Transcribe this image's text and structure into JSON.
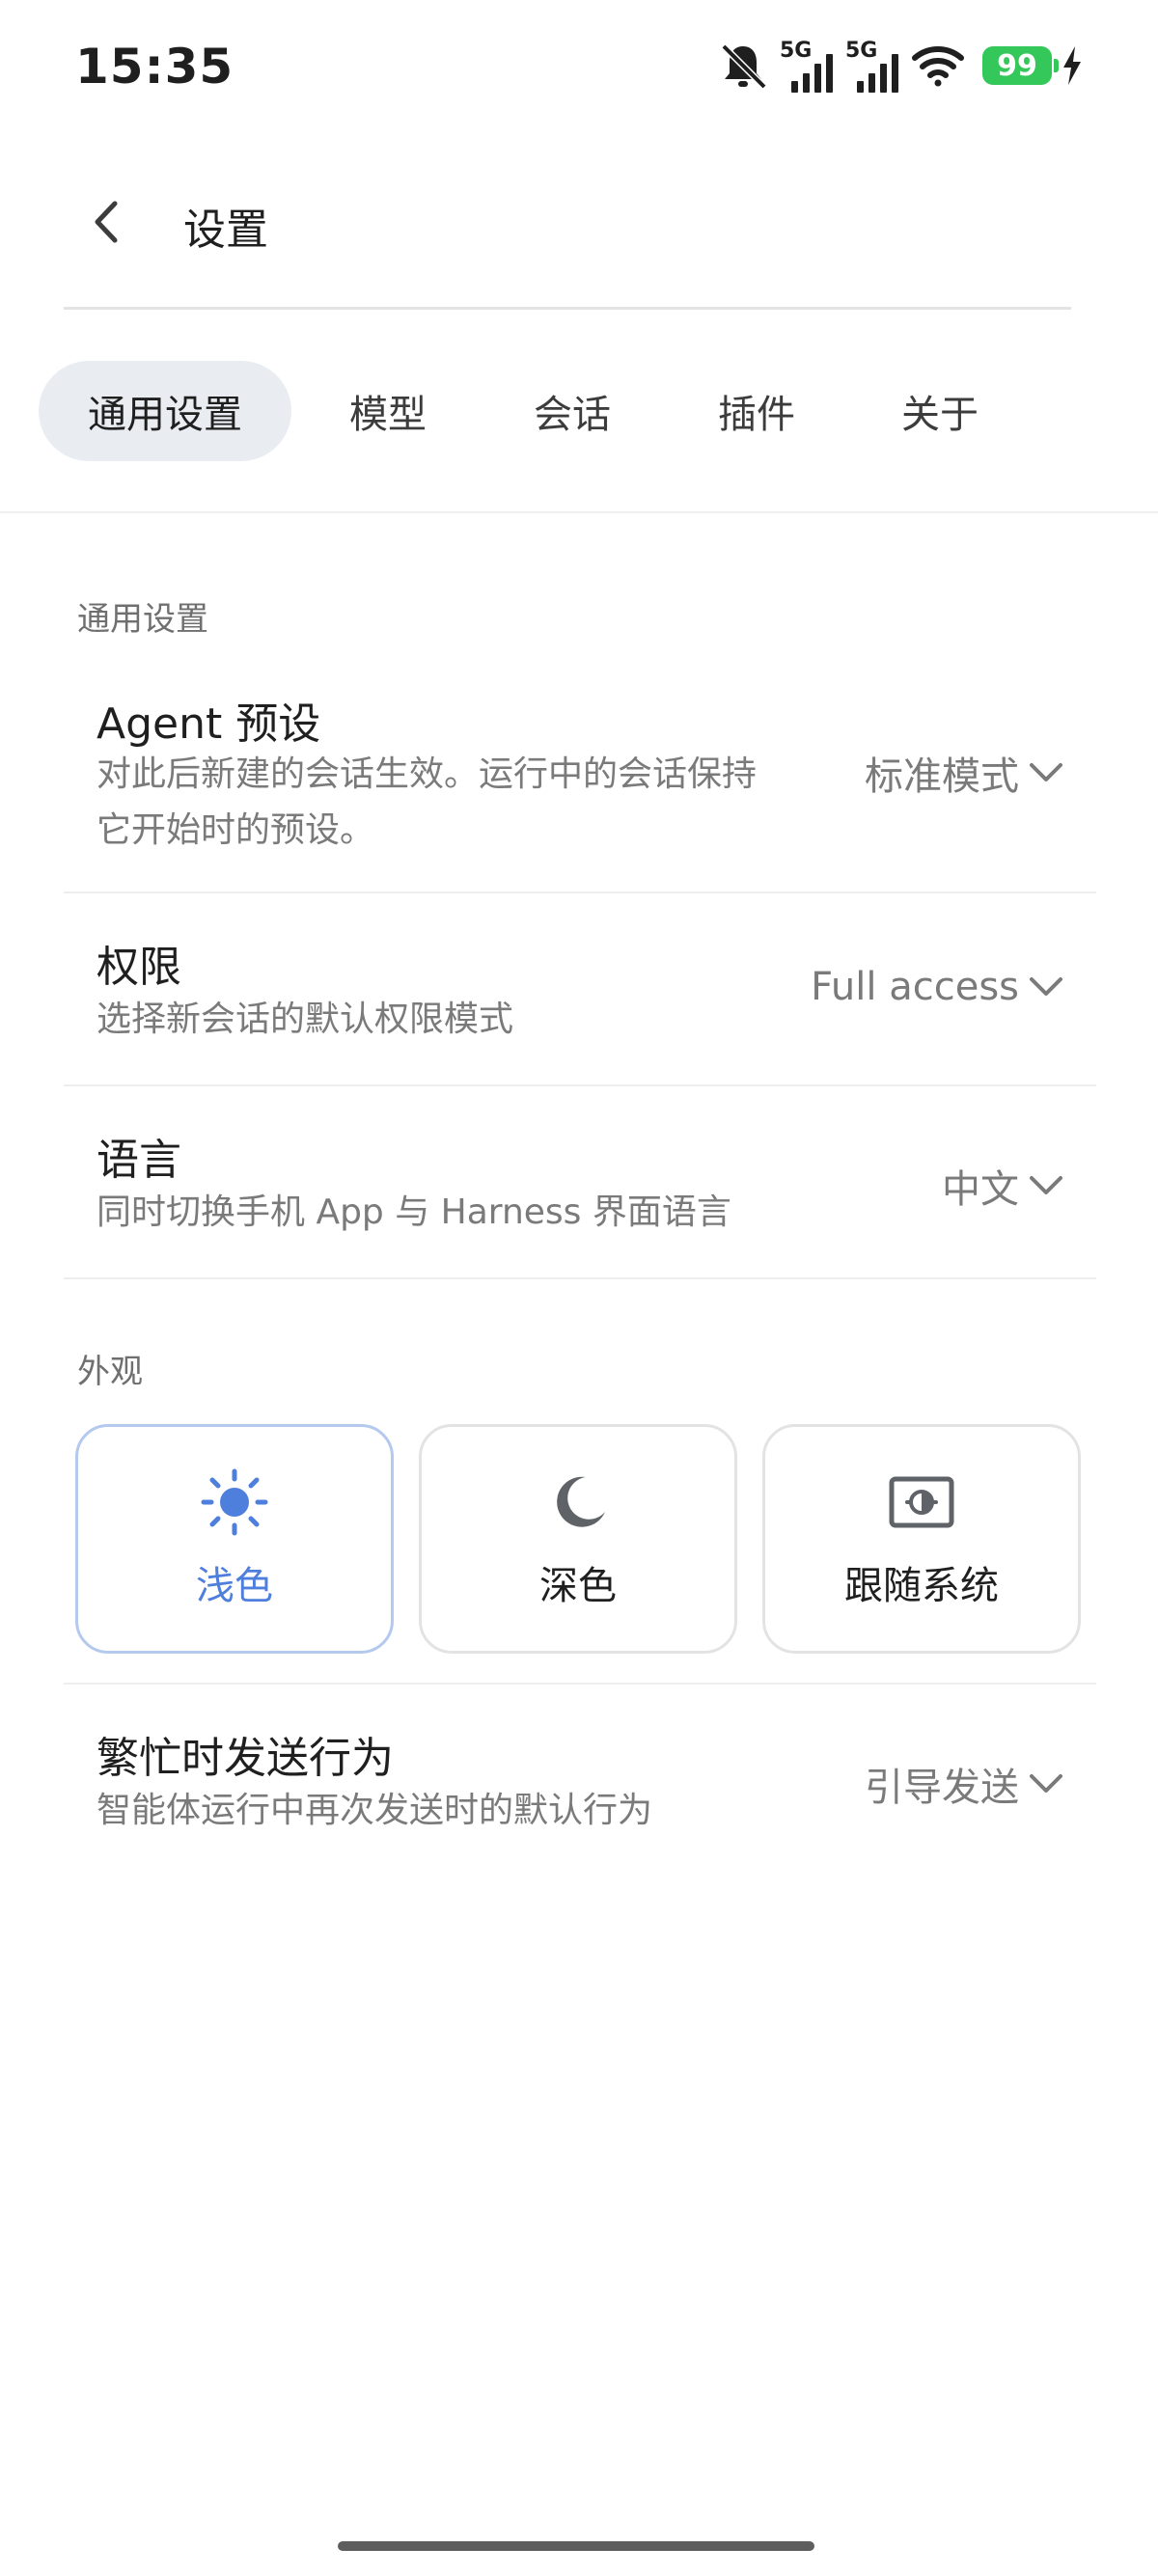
{
  "status_bar": {
    "time": "15:35",
    "network_1": "5G",
    "network_2": "5G",
    "battery": "99",
    "icons": [
      "bell-muted-icon",
      "signal-icon",
      "signal-icon",
      "wifi-icon",
      "battery-icon",
      "charging-bolt-icon"
    ]
  },
  "header": {
    "title": "设置",
    "back_icon": "chevron-left-icon"
  },
  "tabs": [
    {
      "label": "通用设置",
      "active": true
    },
    {
      "label": "模型",
      "active": false
    },
    {
      "label": "会话",
      "active": false
    },
    {
      "label": "插件",
      "active": false
    },
    {
      "label": "关于",
      "active": false
    }
  ],
  "general": {
    "section_label": "通用设置",
    "agent_preset": {
      "title": "Agent 预设",
      "desc_line1": "对此后新建的会话生效。运行中的会话保持",
      "desc_line2": "它开始时的预设。",
      "value": "标准模式"
    },
    "permissions": {
      "title": "权限",
      "desc": "选择新会话的默认权限模式",
      "value": "Full access"
    },
    "language": {
      "title": "语言",
      "desc": "同时切换手机 App 与 Harness 界面语言",
      "value": "中文"
    }
  },
  "appearance": {
    "section_label": "外观",
    "options": [
      {
        "label": "浅色",
        "icon": "sun-icon",
        "selected": true
      },
      {
        "label": "深色",
        "icon": "moon-icon",
        "selected": false
      },
      {
        "label": "跟随系统",
        "icon": "brightness-auto-icon",
        "selected": false
      }
    ]
  },
  "busy_send": {
    "title": "繁忙时发送行为",
    "desc": "智能体运行中再次发送时的默认行为",
    "value": "引导发送"
  },
  "colors": {
    "accent": "#4f7fdc",
    "active_tab_bg": "#e9edf2",
    "battery": "#34c759"
  }
}
